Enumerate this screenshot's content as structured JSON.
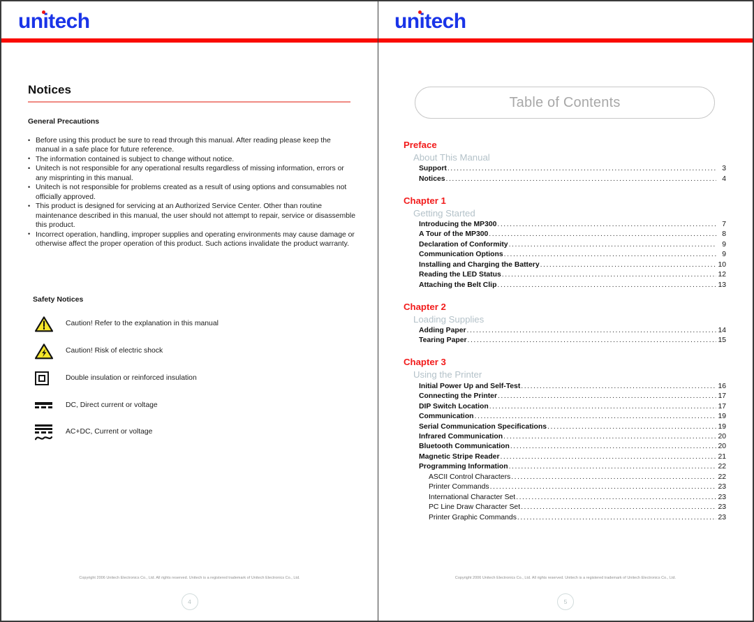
{
  "brand": {
    "logo_text": "unitech",
    "logo_color": "#1a34e8",
    "logo_dot_color": "#ee1111",
    "rule_color": "#fa0a00"
  },
  "left_page": {
    "heading": "Notices",
    "heading_underline_color": "#ef8a83",
    "precautions_subheading": "General Precautions",
    "precautions": [
      "Before using this product be sure to read through this manual. After reading please keep the manual in a safe place for future reference.",
      "The information contained is subject to change without notice.",
      "Unitech is not responsible for any operational results regardless of missing information, errors or any misprinting in this manual.",
      "Unitech is not responsible for problems created as a result of using options and consumables not officially approved.",
      "This product is designed for servicing at an Authorized Service Center. Other than routine maintenance described in this manual, the user should not attempt to repair, service or disassemble this product.",
      "Incorrect operation, handling, improper supplies and operating environments may cause damage or otherwise affect the proper operation of this product. Such actions invalidate the product warranty."
    ],
    "safety_subheading": "Safety Notices",
    "safety_items": [
      {
        "icon": "caution-triangle-exclamation-icon",
        "text": "Caution!  Refer to the explanation in this manual"
      },
      {
        "icon": "caution-triangle-lightning-icon",
        "text": "Caution!  Risk of electric shock"
      },
      {
        "icon": "double-insulation-square-icon",
        "text": "Double insulation or reinforced insulation"
      },
      {
        "icon": "dc-current-icon",
        "text": "DC, Direct current or voltage"
      },
      {
        "icon": "ac-dc-current-icon",
        "text": "AC+DC, Current or voltage"
      }
    ],
    "footer_copyright": "Copyright 2006 Unitech Electronics Co., Ltd. All rights reserved. Unitech is a registered trademark of Unitech Electronics Co., Ltd.",
    "page_number": "4"
  },
  "right_page": {
    "toc_title": "Table of Contents",
    "sections": [
      {
        "chapter": "Preface",
        "section": "About This Manual",
        "entries": [
          {
            "title": "Support",
            "page": "3",
            "level": 1
          },
          {
            "title": "Notices",
            "page": "4",
            "level": 1
          }
        ]
      },
      {
        "chapter": "Chapter 1",
        "section": "Getting Started",
        "entries": [
          {
            "title": "Introducing the MP300",
            "page": "7",
            "level": 1
          },
          {
            "title": "A Tour of the MP300",
            "page": "8",
            "level": 1
          },
          {
            "title": "Declaration of Conformity",
            "page": "9",
            "level": 1
          },
          {
            "title": "Communication Options",
            "page": "9",
            "level": 1
          },
          {
            "title": "Installing and Charging the Battery",
            "page": "10",
            "level": 1
          },
          {
            "title": "Reading the LED Status",
            "page": "12",
            "level": 1
          },
          {
            "title": "Attaching the Belt Clip",
            "page": "13",
            "level": 1
          }
        ]
      },
      {
        "chapter": "Chapter 2",
        "section": "Loading Supplies",
        "entries": [
          {
            "title": "Adding Paper",
            "page": "14",
            "level": 1
          },
          {
            "title": "Tearing Paper",
            "page": "15",
            "level": 1
          }
        ]
      },
      {
        "chapter": "Chapter 3",
        "section": "Using the Printer",
        "entries": [
          {
            "title": "Initial Power Up and Self-Test",
            "page": "16",
            "level": 1
          },
          {
            "title": "Connecting the Printer",
            "page": "17",
            "level": 1
          },
          {
            "title": "DIP Switch Location",
            "page": "17",
            "level": 1
          },
          {
            "title": "Communication",
            "page": "19",
            "level": 1
          },
          {
            "title": "Serial Communication Specifications",
            "page": "19",
            "level": 1
          },
          {
            "title": "Infrared Communication",
            "page": "20",
            "level": 1
          },
          {
            "title": "Bluetooth Communication",
            "page": "20",
            "level": 1
          },
          {
            "title": "Magnetic Stripe Reader",
            "page": "21",
            "level": 1
          },
          {
            "title": "Programming Information",
            "page": "22",
            "level": 1
          },
          {
            "title": "ASCII Control Characters",
            "page": "22",
            "level": 2
          },
          {
            "title": "Printer Commands",
            "page": "23",
            "level": 2
          },
          {
            "title": "International Character Set",
            "page": "23",
            "level": 2
          },
          {
            "title": "PC Line Draw Character Set",
            "page": "23",
            "level": 2
          },
          {
            "title": "Printer Graphic Commands",
            "page": "23",
            "level": 2
          }
        ]
      }
    ],
    "footer_copyright": "Copyright 2006 Unitech Electronics Co., Ltd. All rights reserved. Unitech is a registered trademark of Unitech Electronics Co., Ltd.",
    "page_number": "5"
  },
  "colors": {
    "chapter_red": "#f21a1a",
    "section_gray": "#b4c2c9",
    "toc_title_gray": "#a8a8a8",
    "page_number_gray": "#b6c2c2"
  }
}
